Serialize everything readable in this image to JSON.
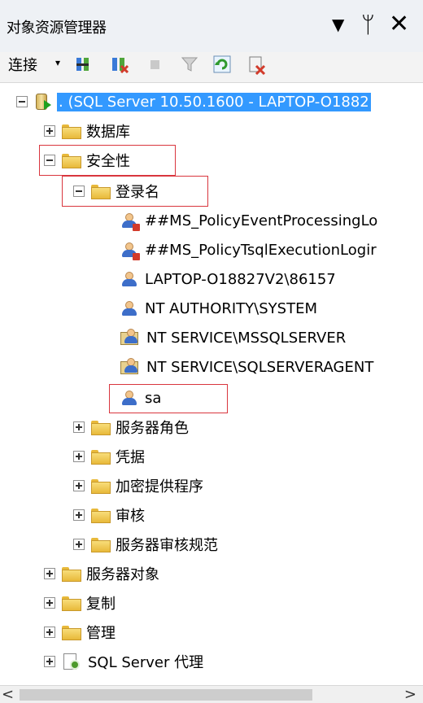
{
  "window": {
    "title": "对象资源管理器",
    "dropdown_icon": "dropdown-arrow-icon",
    "pin_glyph": "ᛘ",
    "close_glyph": "✕"
  },
  "toolbar": {
    "connect_label": "连接",
    "connect_arrow": "▾",
    "icons": [
      "connect-object-explorer-icon",
      "disconnect-icon",
      "stop-icon",
      "filter-icon",
      "refresh-icon",
      "summary-icon"
    ]
  },
  "tree": {
    "server": ". (SQL Server 10.50.1600 - LAPTOP-O1882",
    "databases": "数据库",
    "security": "安全性",
    "logins": "登录名",
    "login_items": [
      "##MS_PolicyEventProcessingLo",
      "##MS_PolicyTsqlExecutionLogir",
      "LAPTOP-O18827V2\\86157",
      "NT AUTHORITY\\SYSTEM",
      "NT SERVICE\\MSSQLSERVER",
      "NT SERVICE\\SQLSERVERAGENT",
      "sa"
    ],
    "server_roles": "服务器角色",
    "credentials": "凭据",
    "crypto_providers": "加密提供程序",
    "audits": "审核",
    "audit_specs": "服务器审核规范",
    "server_objects": "服务器对象",
    "replication": "复制",
    "management": "管理",
    "agent": "SQL Server 代理"
  },
  "scrollbar": {
    "left": "<",
    "right": ">"
  },
  "colors": {
    "selection": "#3399ff",
    "highlight_box": "#d9363e",
    "folder": "#e8b93a"
  }
}
